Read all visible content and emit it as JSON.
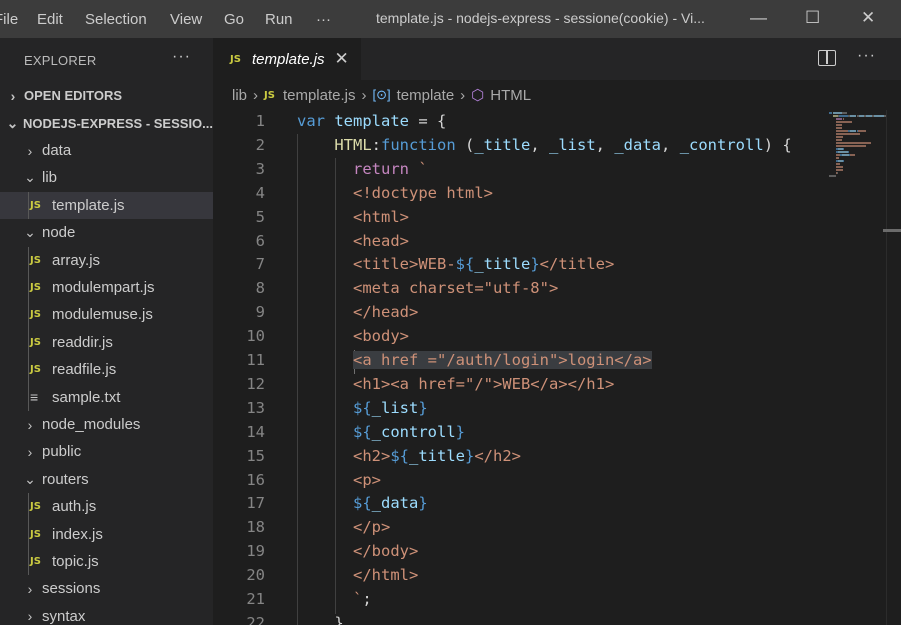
{
  "menubar": {
    "items": [
      "File",
      "Edit",
      "Selection",
      "View",
      "Go",
      "Run",
      "···"
    ],
    "title": "template.js - nodejs-express - sessione(cookie) - Vi..."
  },
  "window_controls": {
    "minimize": "—",
    "maximize": "☐",
    "close": "✕"
  },
  "explorer": {
    "header": "EXPLORER",
    "more": "···",
    "sections": {
      "open_editors": "OPEN EDITORS",
      "workspace": "NODEJS-EXPRESS - SESSIO..."
    },
    "tree": [
      {
        "label": "data",
        "type": "folder",
        "expanded": false,
        "depth": 1
      },
      {
        "label": "lib",
        "type": "folder",
        "expanded": true,
        "depth": 1
      },
      {
        "label": "template.js",
        "type": "js",
        "depth": 2,
        "selected": true
      },
      {
        "label": "node",
        "type": "folder",
        "expanded": true,
        "depth": 1
      },
      {
        "label": "array.js",
        "type": "js",
        "depth": 2
      },
      {
        "label": "modulempart.js",
        "type": "js",
        "depth": 2
      },
      {
        "label": "modulemuse.js",
        "type": "js",
        "depth": 2
      },
      {
        "label": "readdir.js",
        "type": "js",
        "depth": 2
      },
      {
        "label": "readfile.js",
        "type": "js",
        "depth": 2
      },
      {
        "label": "sample.txt",
        "type": "txt",
        "depth": 2
      },
      {
        "label": "node_modules",
        "type": "folder",
        "expanded": false,
        "depth": 1
      },
      {
        "label": "public",
        "type": "folder",
        "expanded": false,
        "depth": 1
      },
      {
        "label": "routers",
        "type": "folder",
        "expanded": true,
        "depth": 1
      },
      {
        "label": "auth.js",
        "type": "js",
        "depth": 2
      },
      {
        "label": "index.js",
        "type": "js",
        "depth": 2
      },
      {
        "label": "topic.js",
        "type": "js",
        "depth": 2
      },
      {
        "label": "sessions",
        "type": "folder",
        "expanded": false,
        "depth": 1
      },
      {
        "label": "syntax",
        "type": "folder",
        "expanded": false,
        "depth": 1
      }
    ]
  },
  "tab": {
    "icon": "JS",
    "label": "template.js",
    "close": "✕"
  },
  "editor_actions": {
    "more": "···"
  },
  "breadcrumb": {
    "folder": "lib",
    "file": "template.js",
    "variable": "template",
    "method": "HTML"
  },
  "icons": {
    "js": "JS",
    "txt": "≡",
    "chevron_right": "›",
    "chevron_down": "⌄"
  },
  "colors": {
    "keyword": "#569cd6",
    "variable": "#9cdcfe",
    "function": "#dcdcaa",
    "string": "#ce9178",
    "control": "#c586c0",
    "js_icon": "#cbcb41"
  },
  "code": {
    "line_numbers": [
      "1",
      "2",
      "3",
      "4",
      "5",
      "6",
      "7",
      "8",
      "9",
      "10",
      "11",
      "12",
      "13",
      "14",
      "15",
      "16",
      "17",
      "18",
      "19",
      "20",
      "21",
      "22"
    ],
    "lines": [
      [
        [
          "k",
          "var"
        ],
        [
          "p",
          " "
        ],
        [
          "v",
          "template"
        ],
        [
          "p",
          " = {"
        ]
      ],
      [
        [
          "p",
          "    "
        ],
        [
          "f",
          "HTML"
        ],
        [
          "p",
          ":"
        ],
        [
          "k",
          "function"
        ],
        [
          "p",
          " ("
        ],
        [
          "v",
          "_title"
        ],
        [
          "p",
          ", "
        ],
        [
          "v",
          "_list"
        ],
        [
          "p",
          ", "
        ],
        [
          "v",
          "_data"
        ],
        [
          "p",
          ", "
        ],
        [
          "v",
          "_controll"
        ],
        [
          "p",
          ") {"
        ]
      ],
      [
        [
          "p",
          "      "
        ],
        [
          "r",
          "return"
        ],
        [
          "p",
          " "
        ],
        [
          "s",
          "`"
        ]
      ],
      [
        [
          "p",
          "      "
        ],
        [
          "s",
          "<!doctype html>"
        ]
      ],
      [
        [
          "p",
          "      "
        ],
        [
          "s",
          "<html>"
        ]
      ],
      [
        [
          "p",
          "      "
        ],
        [
          "s",
          "<head>"
        ]
      ],
      [
        [
          "p",
          "      "
        ],
        [
          "s",
          "<title>WEB-"
        ],
        [
          "k",
          "${"
        ],
        [
          "v",
          "_title"
        ],
        [
          "k",
          "}"
        ],
        [
          "s",
          "</title>"
        ]
      ],
      [
        [
          "p",
          "      "
        ],
        [
          "s",
          "<meta charset=\"utf-8\">"
        ]
      ],
      [
        [
          "p",
          "      "
        ],
        [
          "s",
          "</head>"
        ]
      ],
      [
        [
          "p",
          "      "
        ],
        [
          "s",
          "<body>"
        ]
      ],
      [
        [
          "p",
          "      "
        ],
        [
          "h",
          "<a href =\"/auth/login\">login</a>"
        ]
      ],
      [
        [
          "p",
          "      "
        ],
        [
          "s",
          "<h1><a href=\"/\">WEB</a></h1>"
        ]
      ],
      [
        [
          "p",
          "      "
        ],
        [
          "k",
          "${"
        ],
        [
          "v",
          "_list"
        ],
        [
          "k",
          "}"
        ]
      ],
      [
        [
          "p",
          "      "
        ],
        [
          "k",
          "${"
        ],
        [
          "v",
          "_controll"
        ],
        [
          "k",
          "}"
        ]
      ],
      [
        [
          "p",
          "      "
        ],
        [
          "s",
          "<h2>"
        ],
        [
          "k",
          "${"
        ],
        [
          "v",
          "_title"
        ],
        [
          "k",
          "}"
        ],
        [
          "s",
          "</h2>"
        ]
      ],
      [
        [
          "p",
          "      "
        ],
        [
          "s",
          "<p>"
        ]
      ],
      [
        [
          "p",
          "      "
        ],
        [
          "k",
          "${"
        ],
        [
          "v",
          "_data"
        ],
        [
          "k",
          "}"
        ]
      ],
      [
        [
          "p",
          "      "
        ],
        [
          "s",
          "</p>"
        ]
      ],
      [
        [
          "p",
          "      "
        ],
        [
          "s",
          "</body>"
        ]
      ],
      [
        [
          "p",
          "      "
        ],
        [
          "s",
          "</html>"
        ]
      ],
      [
        [
          "p",
          "      "
        ],
        [
          "s",
          "`"
        ],
        [
          "p",
          ";"
        ]
      ],
      [
        [
          "p",
          "    },"
        ]
      ]
    ]
  }
}
